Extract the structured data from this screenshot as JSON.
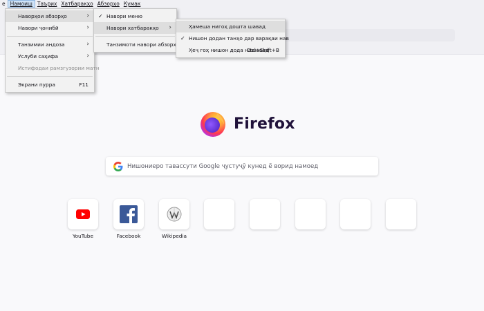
{
  "menubar": {
    "items": [
      "е",
      "Намоиш",
      "Таърих",
      "Хатбаракҳо",
      "Абзорҳо",
      "Кумак"
    ]
  },
  "view_menu": {
    "items": [
      {
        "label": "Наворҳои абзорҳо",
        "has_submenu": true
      },
      {
        "label": "Навори ҷонибӣ",
        "has_submenu": true
      },
      {
        "label": "Танзимии андоза",
        "has_submenu": true
      },
      {
        "label": "Услуби саҳифа",
        "has_submenu": true
      },
      {
        "label": "Истифодаи рамзгузории матн"
      },
      {
        "label": "Экрани пурра",
        "accel": "F11"
      }
    ]
  },
  "toolbars_menu": {
    "items": [
      {
        "label": "Навори меню",
        "checked": true
      },
      {
        "label": "Навори хатбаракҳо",
        "has_submenu": true
      },
      {
        "label": "Танзимоти навори абзорҳо..."
      }
    ]
  },
  "bookmarks_menu": {
    "items": [
      {
        "label": "Ҳамеша нигоҳ дошта шавад"
      },
      {
        "label": "Нишон додан танҳо дар варақаи нав",
        "checked": true
      },
      {
        "label": "Ҳеҷ гоҳ нишон дода нашавад",
        "accel": "Ctrl+Shift+B"
      }
    ]
  },
  "newtab": {
    "brand": "Firefox",
    "search_placeholder": "Нишониеро тавассути Google ҷустуҷӯ кунед ё ворид намоед",
    "tiles": [
      {
        "label": "YouTube",
        "icon": "youtube-icon"
      },
      {
        "label": "Facebook",
        "icon": "facebook-icon"
      },
      {
        "label": "Wikipedia",
        "icon": "wikipedia-icon"
      },
      {
        "label": ""
      },
      {
        "label": ""
      },
      {
        "label": ""
      },
      {
        "label": ""
      },
      {
        "label": ""
      }
    ]
  },
  "colors": {
    "background": "#f9f9fb",
    "menu_bg": "#f2f2f2",
    "menu_highlight": "#dedede",
    "youtube_red": "#ff0000",
    "facebook_blue": "#3b5998"
  }
}
